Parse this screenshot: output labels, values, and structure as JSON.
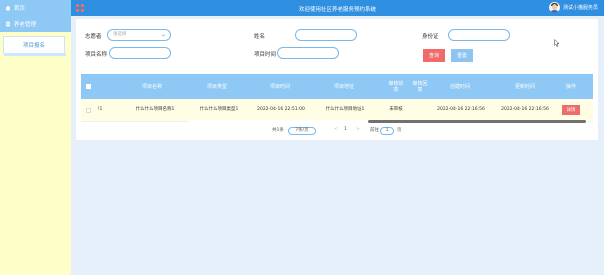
{
  "header": {
    "title": "欢迎使用社区养老服务预约系统",
    "user_name": "测试小猫服务员",
    "colors": {
      "bar": "#2f8fe0"
    }
  },
  "sidebar": {
    "items": [
      {
        "label": "首页",
        "icon": "home-icon"
      },
      {
        "label": "养老管理",
        "icon": "doc-icon"
      }
    ],
    "sub_item": "项目报名",
    "colors": {
      "background": "#fefec8",
      "top": "#8ec8f4"
    }
  },
  "search": {
    "fields": [
      {
        "label": "志愿者",
        "placeholder": "请选择",
        "type": "select"
      },
      {
        "label": "姓名",
        "placeholder": "",
        "type": "text"
      },
      {
        "label": "身份证",
        "placeholder": "",
        "type": "text"
      },
      {
        "label": "项目名称",
        "placeholder": "",
        "type": "text"
      },
      {
        "label": "项目时间",
        "placeholder": "",
        "type": "text"
      }
    ],
    "search_button": "查询",
    "reset_button": "重置"
  },
  "table": {
    "headers": [
      "项目名称",
      "项目类型",
      "项目时间",
      "项目地址",
      "审核状态",
      "审核回复",
      "创建时间",
      "更新时间",
      "操作"
    ],
    "rows": [
      {
        "index": "!1",
        "name": "什么什么项目名称1",
        "type": "什么什么项目类型1",
        "time": "2022-04-16 22:51:00",
        "address": "什么什么项目地址1",
        "status": "未审核",
        "reply": "",
        "created": "2022-04-16 22:16:56",
        "updated": "2022-04-16 22:16:56",
        "action": "详情"
      }
    ],
    "colors": {
      "header": "#8ec8f4",
      "row": "#fffde3",
      "action": "#f06b6b"
    }
  },
  "pagination": {
    "total": "共1条",
    "page_size": "7条/页",
    "prev": "<",
    "page": "1",
    "next": ">",
    "goto_label": "前往",
    "goto_value": "1",
    "goto_suffix": "页"
  }
}
